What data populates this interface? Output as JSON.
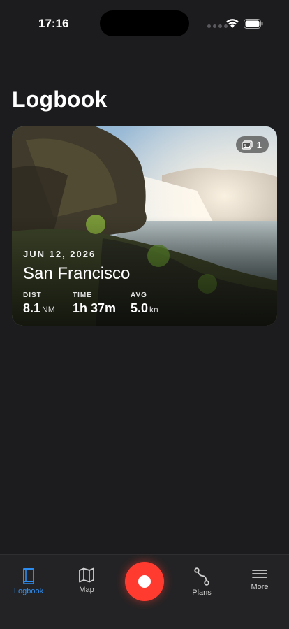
{
  "status_bar": {
    "time": "17:16"
  },
  "header": {
    "title": "Logbook"
  },
  "trip_card": {
    "date": "JUN 12, 2026",
    "location": "San Francisco",
    "photo_count": "1",
    "stats": [
      {
        "label": "DIST",
        "value": "8.1",
        "unit": "NM"
      },
      {
        "label": "TIME",
        "value": "1h 37m",
        "unit": ""
      },
      {
        "label": "AVG",
        "value": "5.0",
        "unit": "kn"
      }
    ]
  },
  "tab_bar": {
    "tabs": [
      {
        "label": "Logbook",
        "icon": "book-icon",
        "active": true
      },
      {
        "label": "Map",
        "icon": "map-icon",
        "active": false
      },
      {
        "label": "Plans",
        "icon": "route-icon",
        "active": false
      },
      {
        "label": "More",
        "icon": "menu-icon",
        "active": false
      }
    ],
    "record_icon": "record-icon"
  },
  "colors": {
    "background": "#1c1c1e",
    "accent": "#2d8cf0",
    "record": "#ff3b30"
  }
}
